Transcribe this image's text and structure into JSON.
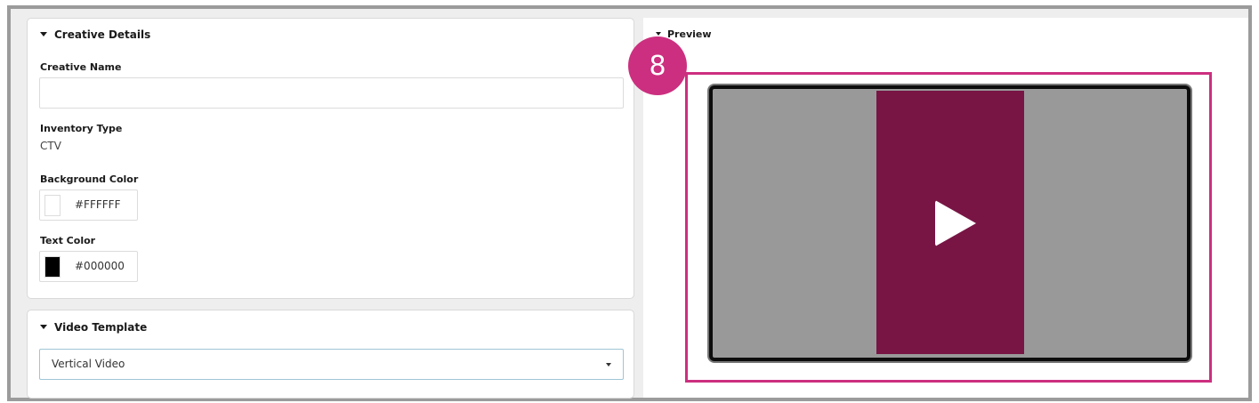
{
  "creative_details": {
    "title": "Creative Details",
    "creative_name": {
      "label": "Creative Name",
      "value": "",
      "placeholder": ""
    },
    "inventory_type": {
      "label": "Inventory Type",
      "value": "CTV"
    },
    "background_color": {
      "label": "Background Color",
      "value": "#FFFFFF",
      "swatch": "#ffffff"
    },
    "text_color": {
      "label": "Text Color",
      "value": "#000000",
      "swatch": "#000000"
    }
  },
  "video_template": {
    "title": "Video Template",
    "selected": "Vertical Video"
  },
  "preview": {
    "title": "Preview",
    "step_number": "8",
    "strip_color": "#781545",
    "highlight_color": "#cc2f7f"
  }
}
